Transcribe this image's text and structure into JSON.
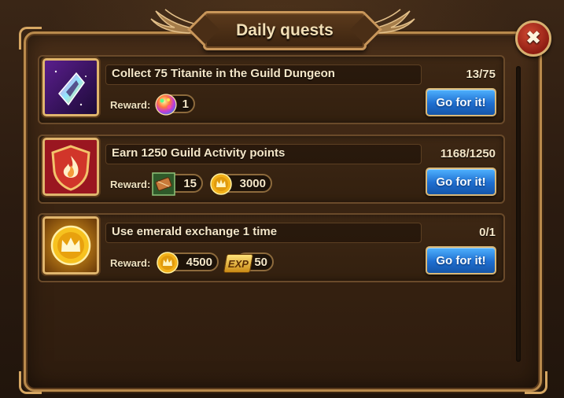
{
  "window": {
    "title": "Daily quests",
    "close_label": "✖"
  },
  "reward_label": "Reward:",
  "button_label": "Go for it!",
  "quests": [
    {
      "title": "Collect 75 Titanite in the Guild Dungeon",
      "progress": "13/75",
      "icon": "titanite-crystal-icon",
      "rewards": [
        {
          "icon": "rainbow-orb-icon",
          "amount": "1"
        }
      ]
    },
    {
      "title": "Earn 1250 Guild Activity points",
      "progress": "1168/1250",
      "icon": "guild-flame-shield-icon",
      "rewards": [
        {
          "icon": "green-scroll-icon",
          "amount": "15"
        },
        {
          "icon": "gold-coin-icon",
          "amount": "3000"
        }
      ]
    },
    {
      "title": "Use emerald exchange 1 time",
      "progress": "0/1",
      "icon": "gold-crown-coin-icon",
      "rewards": [
        {
          "icon": "gold-coin-icon",
          "amount": "4500"
        },
        {
          "icon": "exp-icon",
          "amount": "50",
          "badge_text": "EXP"
        }
      ]
    }
  ],
  "colors": {
    "accent_gold": "#c8965a",
    "button_blue": "#1e6ed0",
    "text": "#f4e6c8"
  }
}
